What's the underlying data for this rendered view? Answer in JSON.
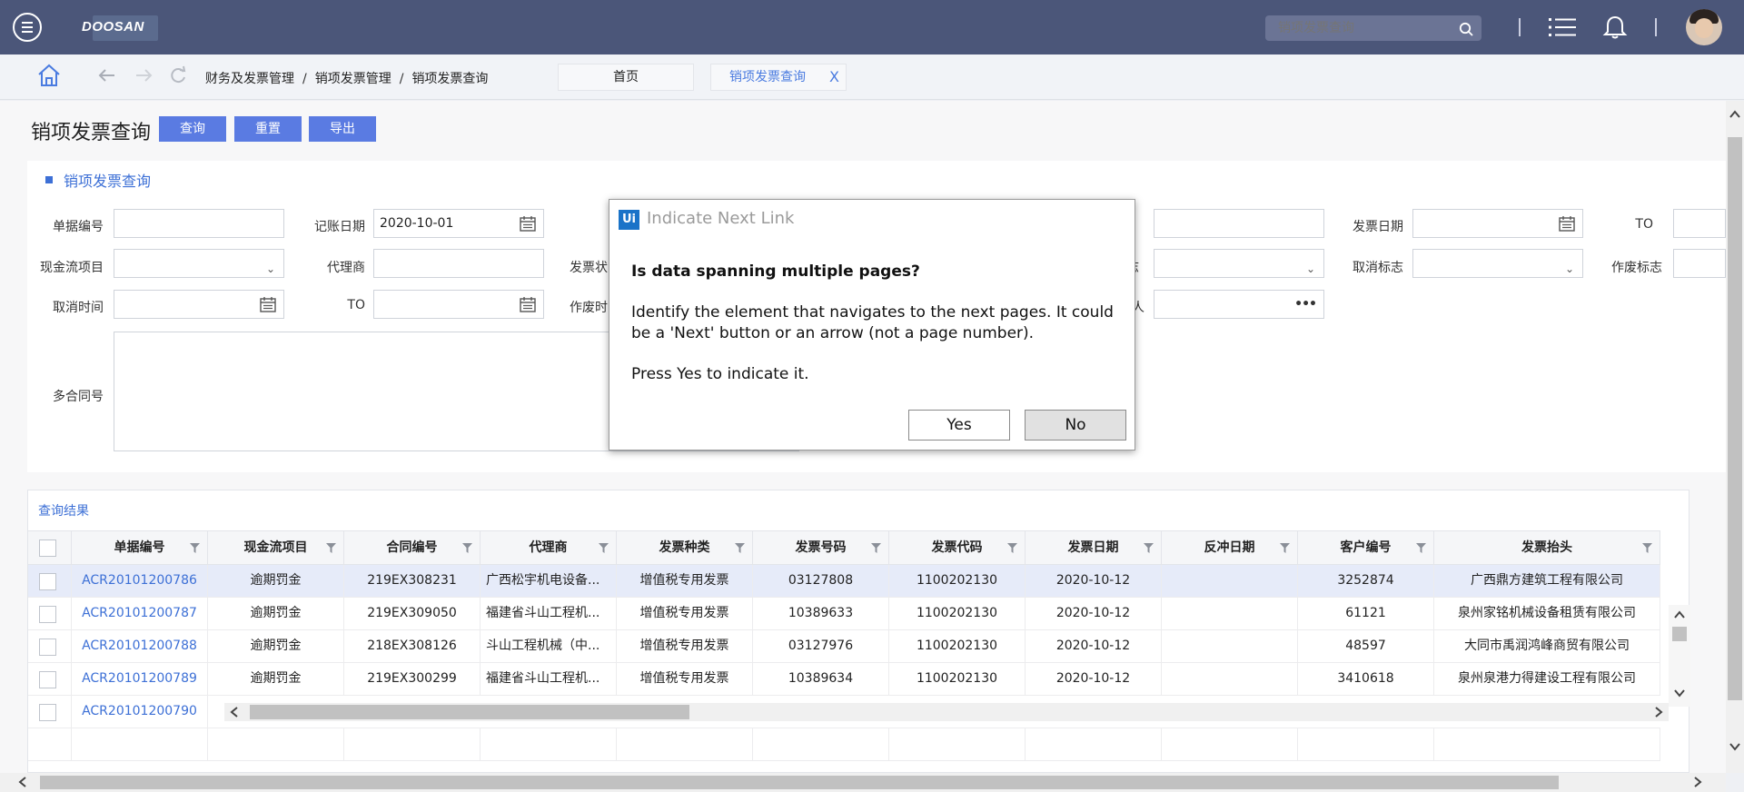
{
  "topbar": {
    "logo": "DOOSAN",
    "search_placeholder": "销项发票查询"
  },
  "navbar": {
    "breadcrumb": [
      "财务及发票管理",
      "销项发票管理",
      "销项发票查询"
    ],
    "breadcrumb_sep": "/",
    "tab_home": "首页",
    "tab_active": "销项发票查询",
    "tab_close": "X"
  },
  "page": {
    "title": "销项发票查询",
    "buttons": {
      "query": "查询",
      "reset": "重置",
      "export": "导出"
    },
    "panel_title": "销项发票查询"
  },
  "form": {
    "doc_no_label": "单据编号",
    "post_date_label": "记账日期",
    "post_date_value": "2020-10-01",
    "to_label_1": "TO",
    "invoice_date_label": "发票日期",
    "to_label_2": "TO",
    "cashflow_label": "现金流项目",
    "agent_label": "代理商",
    "invoice_status_label": "发票状",
    "flag_label_partial": "志",
    "cancel_flag_label": "取消标志",
    "void_flag_label": "作废标志",
    "cancel_time_label": "取消时间",
    "to_label_3": "TO",
    "void_time_label": "作废时",
    "person_label_partial": "人",
    "contract_multi_label": "多合同号"
  },
  "results": {
    "title": "查询结果",
    "columns": [
      "单据编号",
      "现金流项目",
      "合同编号",
      "代理商",
      "发票种类",
      "发票号码",
      "发票代码",
      "发票日期",
      "反冲日期",
      "客户编号",
      "发票抬头"
    ],
    "rows": [
      [
        "ACR20101200786",
        "逾期罚金",
        "219EX308231",
        "广西松宇机电设备...",
        "增值税专用发票",
        "03127808",
        "1100202130",
        "2020-10-12",
        "",
        "3252874",
        "广西鼎方建筑工程有限公司"
      ],
      [
        "ACR20101200787",
        "逾期罚金",
        "219EX309050",
        "福建省斗山工程机...",
        "增值税专用发票",
        "10389633",
        "1100202130",
        "2020-10-12",
        "",
        "61121",
        "泉州家铭机械设备租赁有限公司"
      ],
      [
        "ACR20101200788",
        "逾期罚金",
        "218EX308126",
        "斗山工程机械（中...",
        "增值税专用发票",
        "03127976",
        "1100202130",
        "2020-10-12",
        "",
        "48597",
        "大同市禹润鸿峰商贸有限公司"
      ],
      [
        "ACR20101200789",
        "逾期罚金",
        "219EX300299",
        "福建省斗山工程机...",
        "增值税专用发票",
        "10389634",
        "1100202130",
        "2020-10-12",
        "",
        "3410618",
        "泉州泉港力得建设工程有限公司"
      ]
    ],
    "partial_row_doc_no": "ACR20101200790",
    "selected_row_index": 0
  },
  "modal": {
    "logo": "Ui",
    "title": "Indicate Next Link",
    "question": "Is data spanning multiple pages?",
    "body": "Identify the element that navigates to the next pages. It could be a 'Next' button or an arrow (not a page number).",
    "instruction": "Press Yes to indicate it.",
    "yes_label": "Yes",
    "no_label": "No"
  },
  "colors": {
    "topbar": "#4b5679",
    "accent": "#5a7be2",
    "link": "#3d70d6",
    "selected_row": "#e6ebf9"
  },
  "icons": [
    "menu-icon",
    "search-icon",
    "list-icon",
    "bell-icon",
    "home-icon",
    "back-arrow-icon",
    "forward-arrow-icon",
    "refresh-icon",
    "calendar-icon",
    "chevron-down-icon",
    "filter-icon",
    "more-dots-icon"
  ]
}
